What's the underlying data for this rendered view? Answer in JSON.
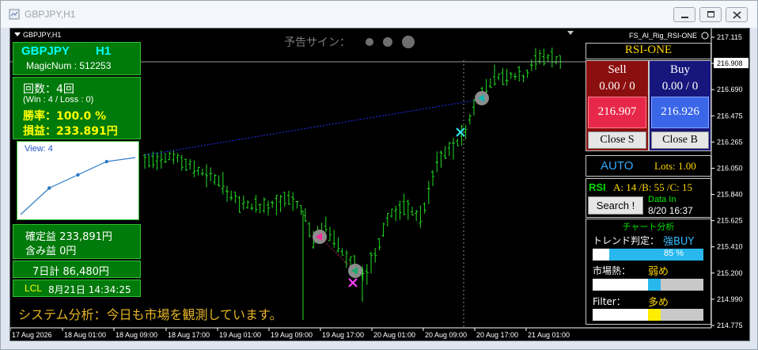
{
  "window": {
    "title": "GBPJPY,H1"
  },
  "chart": {
    "symbol_label": "GBPJPY,H1",
    "indicator_name": "FS_AI_Rig_RSI-ONE",
    "signal_label": "予告サイン：",
    "price_ticks": [
      "217.115",
      "216.908",
      "216.690",
      "216.475",
      "216.265",
      "216.050",
      "215.840",
      "215.625",
      "215.410",
      "215.200",
      "214.990",
      "214.775"
    ],
    "current_price": "216.908",
    "time_ticks": [
      "17 Aug 2026",
      "18 Aug 01:00",
      "18 Aug 09:00",
      "18 Aug 17:00",
      "19 Aug 01:00",
      "19 Aug 09:00",
      "19 Aug 17:00",
      "20 Aug 01:00",
      "20 Aug 09:00",
      "20 Aug 17:00",
      "21 Aug 01:00"
    ],
    "status_text": "システム分析：今日も市場を観測しています。",
    "colors": {
      "bars": "#22dd22",
      "background": "#000000",
      "trend_line": "#2233ff"
    }
  },
  "left_panel": {
    "pair": "GBPJPY",
    "timeframe": "H1",
    "magic": "MagicNum : 512253",
    "count": "回数：4回",
    "win_loss": "(Win :  4 /  Loss :  0)",
    "win_rate": "勝率：100.0 %",
    "pnl": "損益：233.891円",
    "equity_view_label": "View: 4",
    "equity_curve": [
      0,
      2,
      3,
      4,
      4.3
    ],
    "confirmed": "確定益 233,891円",
    "unrealized": "含み益 0円",
    "week_total": "7日計 86,480円",
    "lcl_label": "LCL",
    "lcl_time": "8月21日 14:34:25"
  },
  "right_panel": {
    "title": "RSI-ONE",
    "sell_label": "Sell",
    "sell_count": "0.00 / 0",
    "buy_label": "Buy",
    "buy_count": "0.00 / 0",
    "sell_price": "216.907",
    "buy_price": "216.926",
    "close_s": "Close S",
    "close_b": "Close B",
    "mode": "AUTO",
    "lots": "Lots: 1.00",
    "rsi_label": "RSI",
    "rsi_values": "A: 14 /B: 55 /C: 15",
    "search": "Search !",
    "data_in_label": "Data In",
    "data_in_time": "8/20 16:37",
    "analysis_title": "チャート分析",
    "trend_label": "トレンド判定：",
    "trend_value": "強BUY",
    "trend_percent": "85 %",
    "trend_level": 0.85,
    "heat_label": "市場熱：",
    "heat_value": "弱め",
    "filter_label": "Filter：",
    "filter_value": "多め"
  }
}
